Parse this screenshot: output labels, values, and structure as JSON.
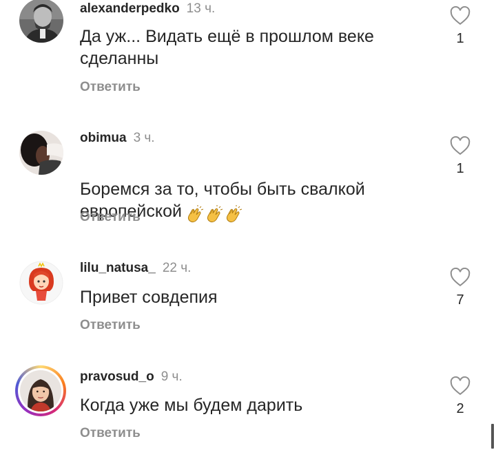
{
  "comments": [
    {
      "username": "alexanderpedko",
      "time": "13 ч.",
      "text": "Да уж... Видать ещё в прошлом веке\nсделанны",
      "reply_label": "Ответить",
      "likes": "1",
      "avatar": "man-portrait-avatar"
    },
    {
      "username": "obimua",
      "time": "3 ч.",
      "text": "Боремся за то, чтобы быть свалкой\nевропейской",
      "emoji": [
        "clapping-hands-icon",
        "clapping-hands-icon",
        "clapping-hands-icon"
      ],
      "reply_label": "Ответить",
      "likes": "1",
      "avatar": "dark-portrait-avatar"
    },
    {
      "username": "lilu_natusa_",
      "time": "22 ч.",
      "text": "Привет совдепия",
      "reply_label": "Ответить",
      "likes": "7",
      "avatar": "cartoon-girl-avatar"
    },
    {
      "username": "pravosud_o",
      "time": "9 ч.",
      "text": "Когда уже мы будем дарить",
      "reply_label": "Ответить",
      "likes": "2",
      "avatar": "woman-portrait-avatar"
    }
  ],
  "colors": {
    "text": "#262626",
    "secondary": "#8e8e8e",
    "clap": "#f5c044"
  }
}
